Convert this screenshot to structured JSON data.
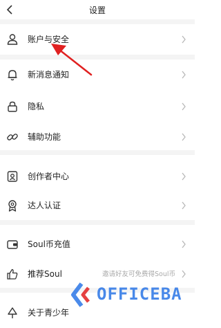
{
  "header": {
    "title": "设置",
    "back_icon": "chevron-left-icon"
  },
  "items": [
    {
      "label": "账户与安全",
      "icon": "person-icon"
    },
    {
      "label": "新消息通知",
      "icon": "bell-icon"
    },
    {
      "label": "隐私",
      "icon": "lock-icon"
    },
    {
      "label": "辅助功能",
      "icon": "link-icon"
    },
    {
      "label": "创作者中心",
      "icon": "creator-card-icon"
    },
    {
      "label": "达人认证",
      "icon": "badge-icon"
    },
    {
      "label": "Soul币充值",
      "icon": "wallet-icon"
    },
    {
      "label": "推荐Soul",
      "icon": "thumbs-up-icon",
      "extra": "邀请好友可免费得Soul币"
    },
    {
      "label": "关于青少年",
      "icon": "tree-icon"
    }
  ],
  "annotation": {
    "type": "red-arrow",
    "color": "#e02020"
  },
  "watermark": {
    "text": "OFFICEBA",
    "color": "#2a75e6"
  }
}
